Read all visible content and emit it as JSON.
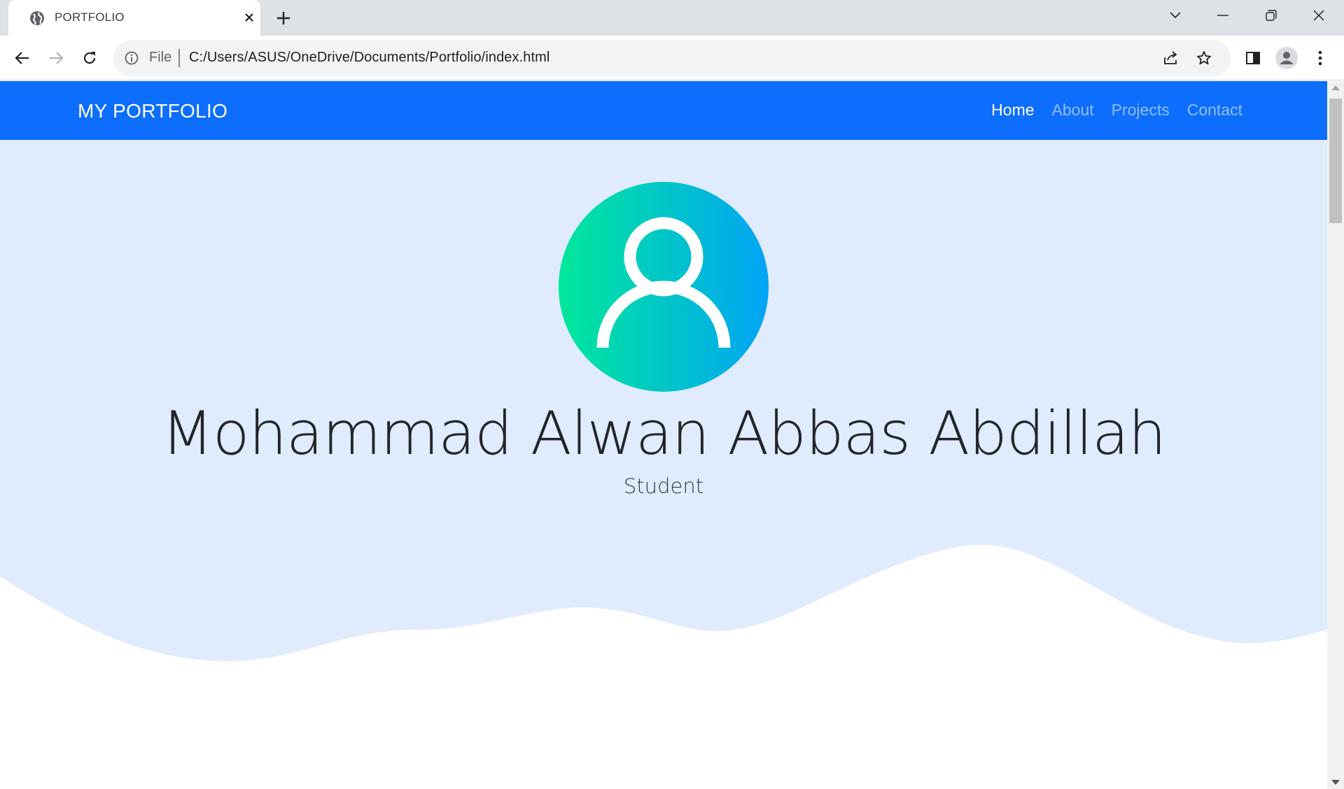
{
  "browser": {
    "tab": {
      "title": "PORTFOLIO",
      "favicon": "globe-icon"
    },
    "address": {
      "scheme": "File",
      "url": "C:/Users/ASUS/OneDrive/Documents/Portfolio/index.html"
    },
    "window_controls": [
      "chevron-down-icon",
      "minimize-icon",
      "restore-icon",
      "close-icon"
    ],
    "toolbar_icons": [
      "back-icon",
      "forward-icon",
      "reload-icon",
      "share-icon",
      "star-icon",
      "side-panel-icon",
      "profile-icon",
      "menu-icon"
    ]
  },
  "navbar": {
    "brand": "MY PORTFOLIO",
    "links": [
      {
        "label": "Home",
        "active": true
      },
      {
        "label": "About",
        "active": false
      },
      {
        "label": "Projects",
        "active": false
      },
      {
        "label": "Contact",
        "active": false
      }
    ]
  },
  "hero": {
    "name": "Mohammad Alwan Abbas Abdillah",
    "role": "Student"
  },
  "colors": {
    "navbar": "#0d6efd",
    "hero_bg": "#e0ebfd",
    "avatar_gradient_start": "#00e89a",
    "avatar_gradient_end": "#00a4f5",
    "text": "#212529"
  }
}
